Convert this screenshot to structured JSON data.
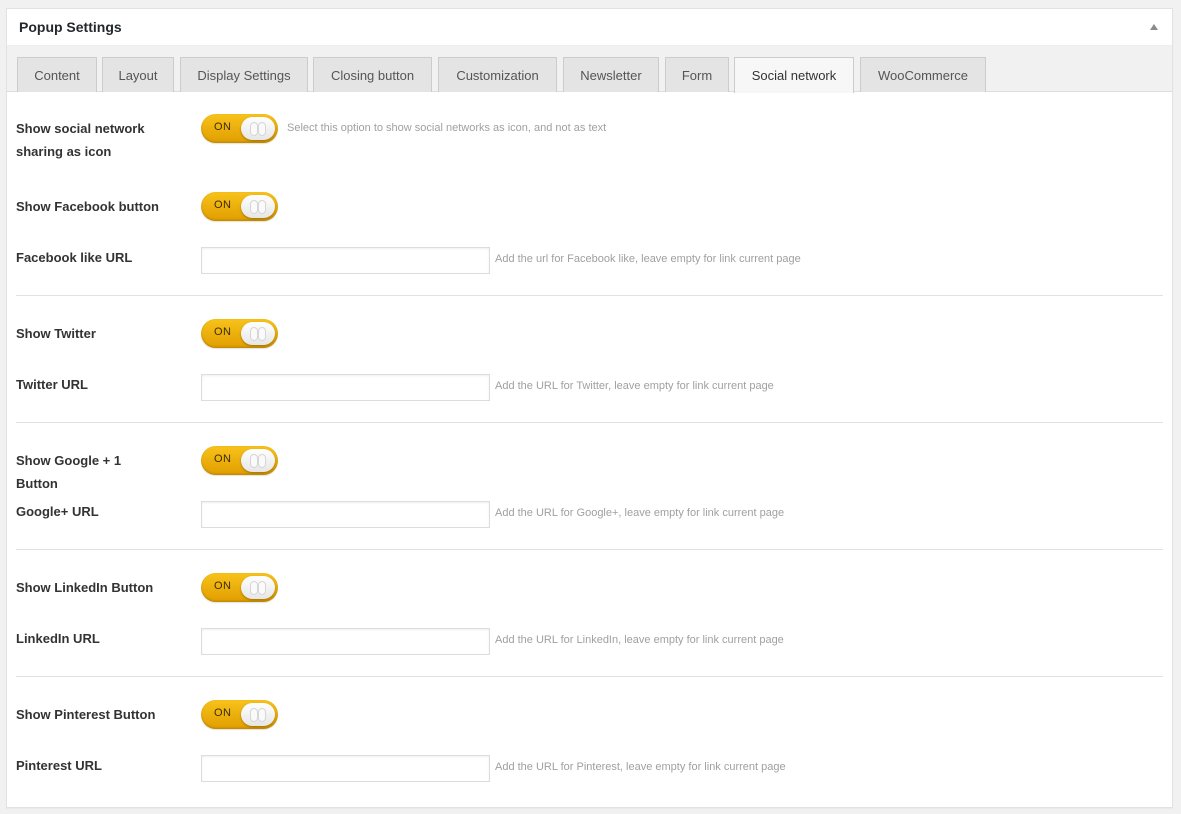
{
  "postbox": {
    "title": "Popup Settings"
  },
  "tabs": [
    {
      "label": "Content"
    },
    {
      "label": "Layout"
    },
    {
      "label": "Display Settings"
    },
    {
      "label": "Closing button"
    },
    {
      "label": "Customization"
    },
    {
      "label": "Newsletter"
    },
    {
      "label": "Form"
    },
    {
      "label": "Social network",
      "active": true
    },
    {
      "label": "WooCommerce"
    }
  ],
  "fields": {
    "social_icon": {
      "label_line1": "Show social network",
      "label_line2": "sharing as icon",
      "switch": "ON",
      "help": "Select this option to show social networks as icon, and not as text"
    },
    "facebook_button": {
      "label": "Show Facebook button",
      "switch": "ON"
    },
    "facebook_url": {
      "label": "Facebook like URL",
      "value": "",
      "help": "Add the url for Facebook like, leave empty for link current page"
    },
    "twitter_button": {
      "label": "Show Twitter",
      "switch": "ON"
    },
    "twitter_url": {
      "label": "Twitter URL",
      "value": "",
      "help": "Add the URL for Twitter, leave empty for link current page"
    },
    "google_button": {
      "label": "Show Google + 1 Button",
      "switch": "ON"
    },
    "google_url": {
      "label": "Google+ URL",
      "value": "",
      "help": "Add the URL for Google+, leave empty for link current page"
    },
    "linkedin_button": {
      "label": "Show LinkedIn Button",
      "switch": "ON"
    },
    "linkedin_url": {
      "label": "LinkedIn URL",
      "value": "",
      "help": "Add the URL for LinkedIn, leave empty for link current page"
    },
    "pinterest_button": {
      "label": "Show Pinterest Button",
      "switch": "ON"
    },
    "pinterest_url": {
      "label": "Pinterest URL",
      "value": "",
      "help": "Add the URL for Pinterest, leave empty for link current page"
    }
  },
  "colors": {
    "switch_on": "#f0b30b",
    "page_bg": "#f1f1f1",
    "help_text": "#a0a0a0"
  }
}
